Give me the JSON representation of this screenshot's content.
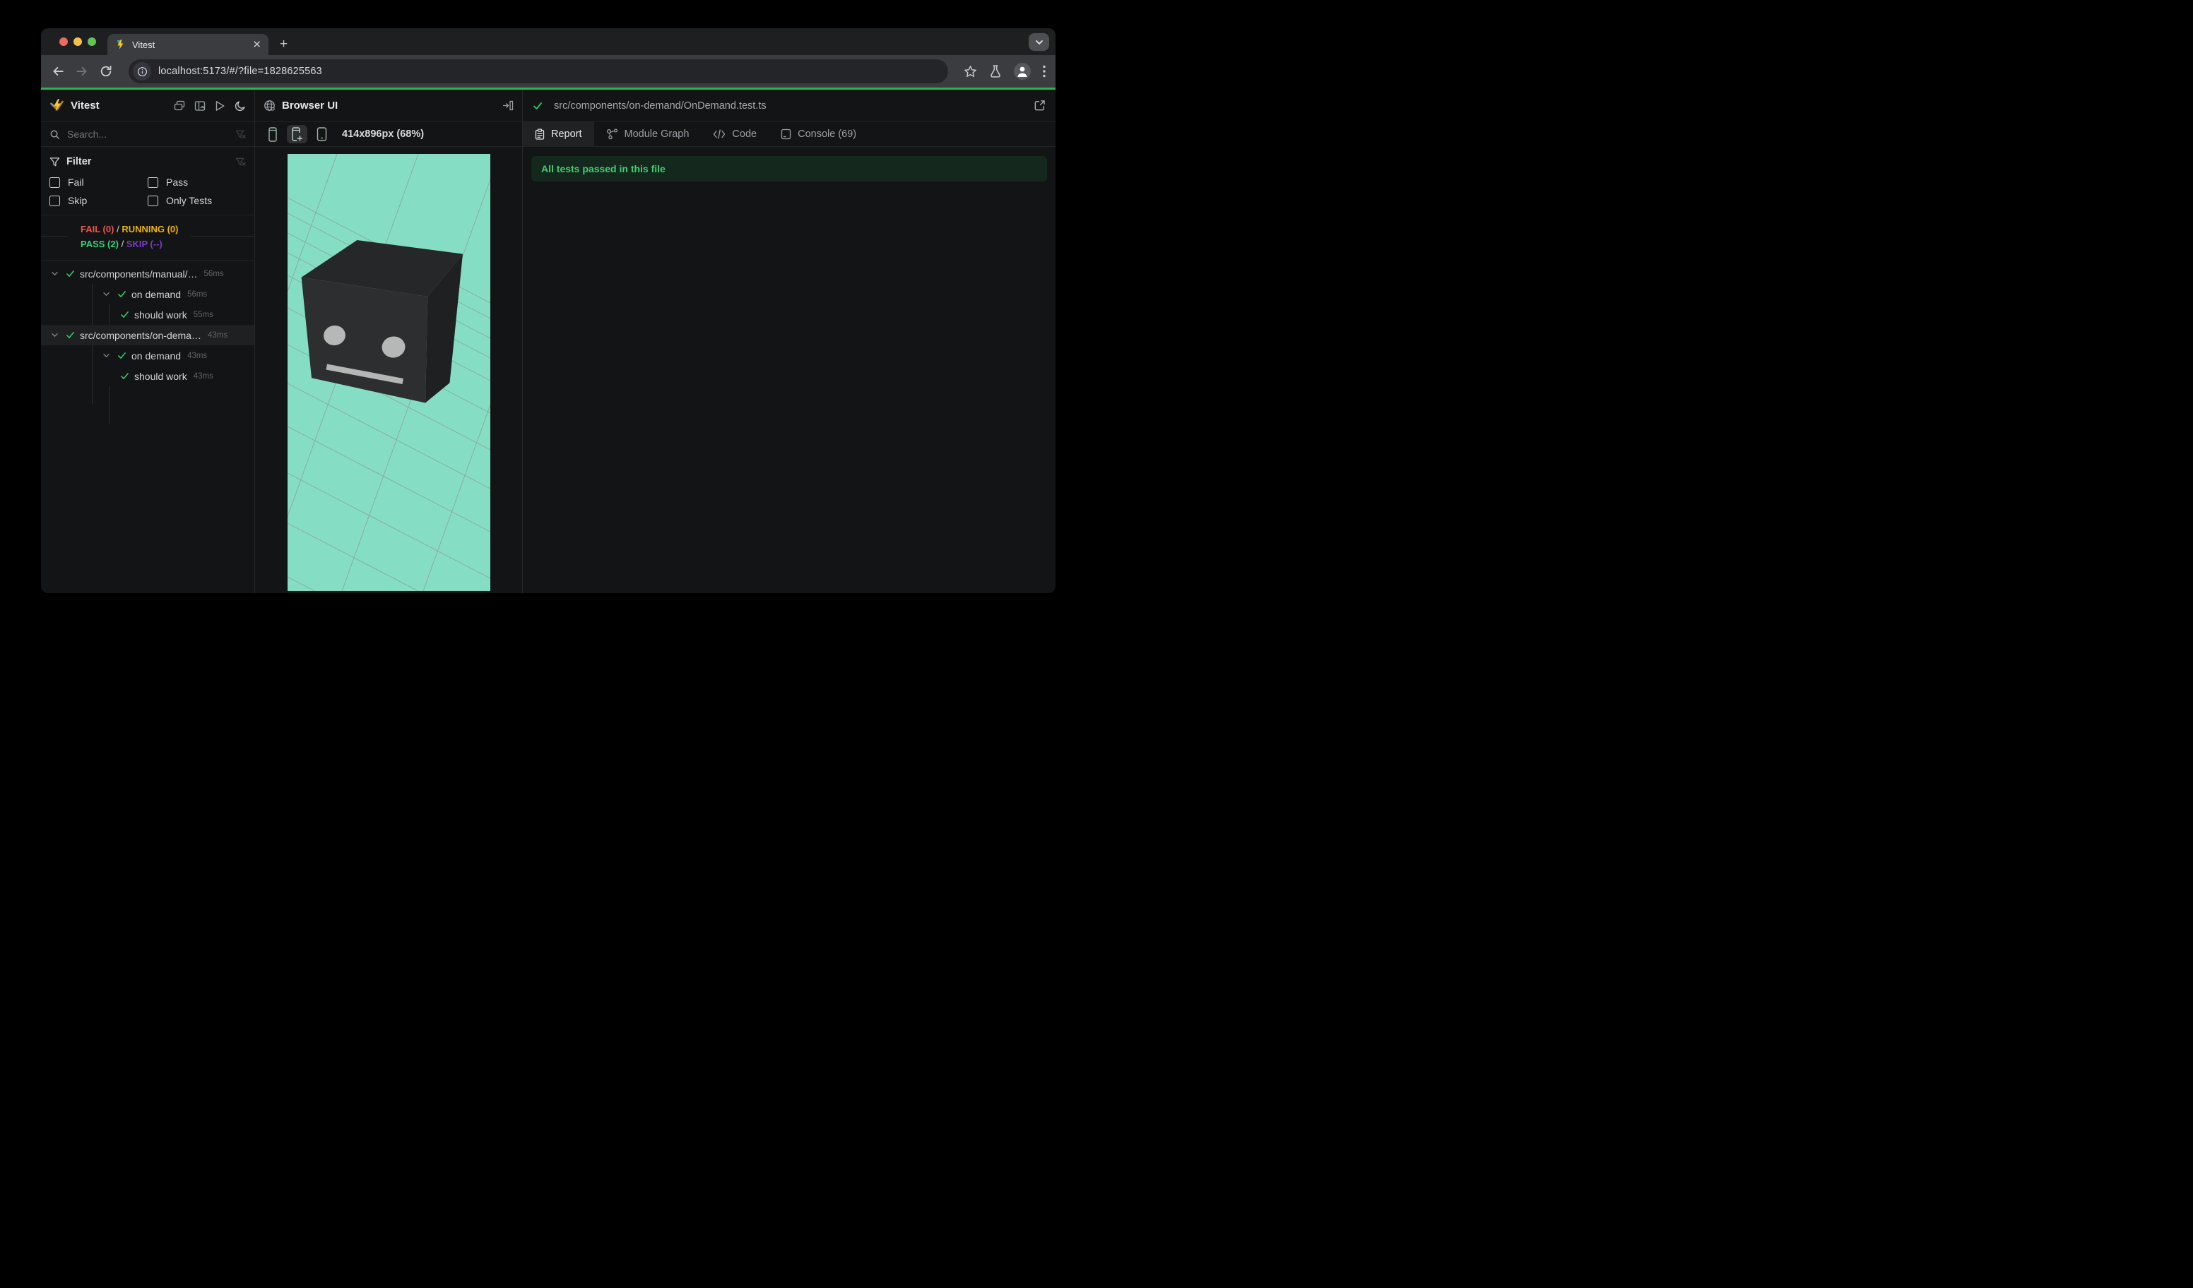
{
  "browser": {
    "tab_title": "Vitest",
    "close_glyph": "✕",
    "new_tab_glyph": "+",
    "url": "localhost:5173/#/?file=1828625563"
  },
  "sidebar": {
    "title": "Vitest",
    "search_placeholder": "Search...",
    "filter": {
      "title": "Filter",
      "options": [
        {
          "label": "Fail",
          "checked": false
        },
        {
          "label": "Pass",
          "checked": false
        },
        {
          "label": "Skip",
          "checked": false
        },
        {
          "label": "Only Tests",
          "checked": false
        }
      ]
    },
    "summary": {
      "fail": "FAIL (0)",
      "sep1": "/",
      "running": "RUNNING (0)",
      "pass": "PASS (2)",
      "sep2": "/",
      "skip": "SKIP (--)"
    },
    "tree": {
      "rows": [
        {
          "label": "src/components/manual/…",
          "duration": "56ms",
          "level": 0,
          "state": "pass",
          "expanded": true
        },
        {
          "label": "on demand",
          "duration": "56ms",
          "level": 1,
          "state": "pass",
          "expanded": true
        },
        {
          "label": "should work",
          "duration": "55ms",
          "level": 2,
          "state": "pass"
        },
        {
          "label": "src/components/on-dema…",
          "duration": "43ms",
          "level": 0,
          "state": "pass",
          "expanded": true,
          "selected": true
        },
        {
          "label": "on demand",
          "duration": "43ms",
          "level": 1,
          "state": "pass",
          "expanded": true
        },
        {
          "label": "should work",
          "duration": "43ms",
          "level": 2,
          "state": "pass"
        }
      ]
    }
  },
  "browser_panel": {
    "title": "Browser UI",
    "resolution": "414x896px (68%)",
    "device_buttons": [
      "device-phone",
      "device-phone-add",
      "device-phone-frame"
    ]
  },
  "right_panel": {
    "file_status": "pass",
    "file_path": "src/components/on-demand/OnDemand.test.ts",
    "tabs": [
      {
        "label": "Report",
        "active": true
      },
      {
        "label": "Module Graph",
        "active": false
      },
      {
        "label": "Code",
        "active": false
      },
      {
        "label": "Console (69)",
        "active": false
      }
    ],
    "banner": "All tests passed in this file"
  },
  "colors": {
    "accent_bar_green": "#28b554",
    "pass_green": "#2fd37a",
    "fail_red": "#f0524a",
    "running_amber": "#eab308",
    "skip_purple": "#7d3ac8",
    "banner_bg": "#15281d",
    "banner_text": "#3ecf70",
    "scene_background_teal": "#85dec4",
    "cube_front": "#2c2e2f",
    "cube_top": "#252728",
    "cube_side": "#1e2021",
    "cube_face_features": "#b6b8b7",
    "vitest_yellow": "#fcc72b"
  }
}
